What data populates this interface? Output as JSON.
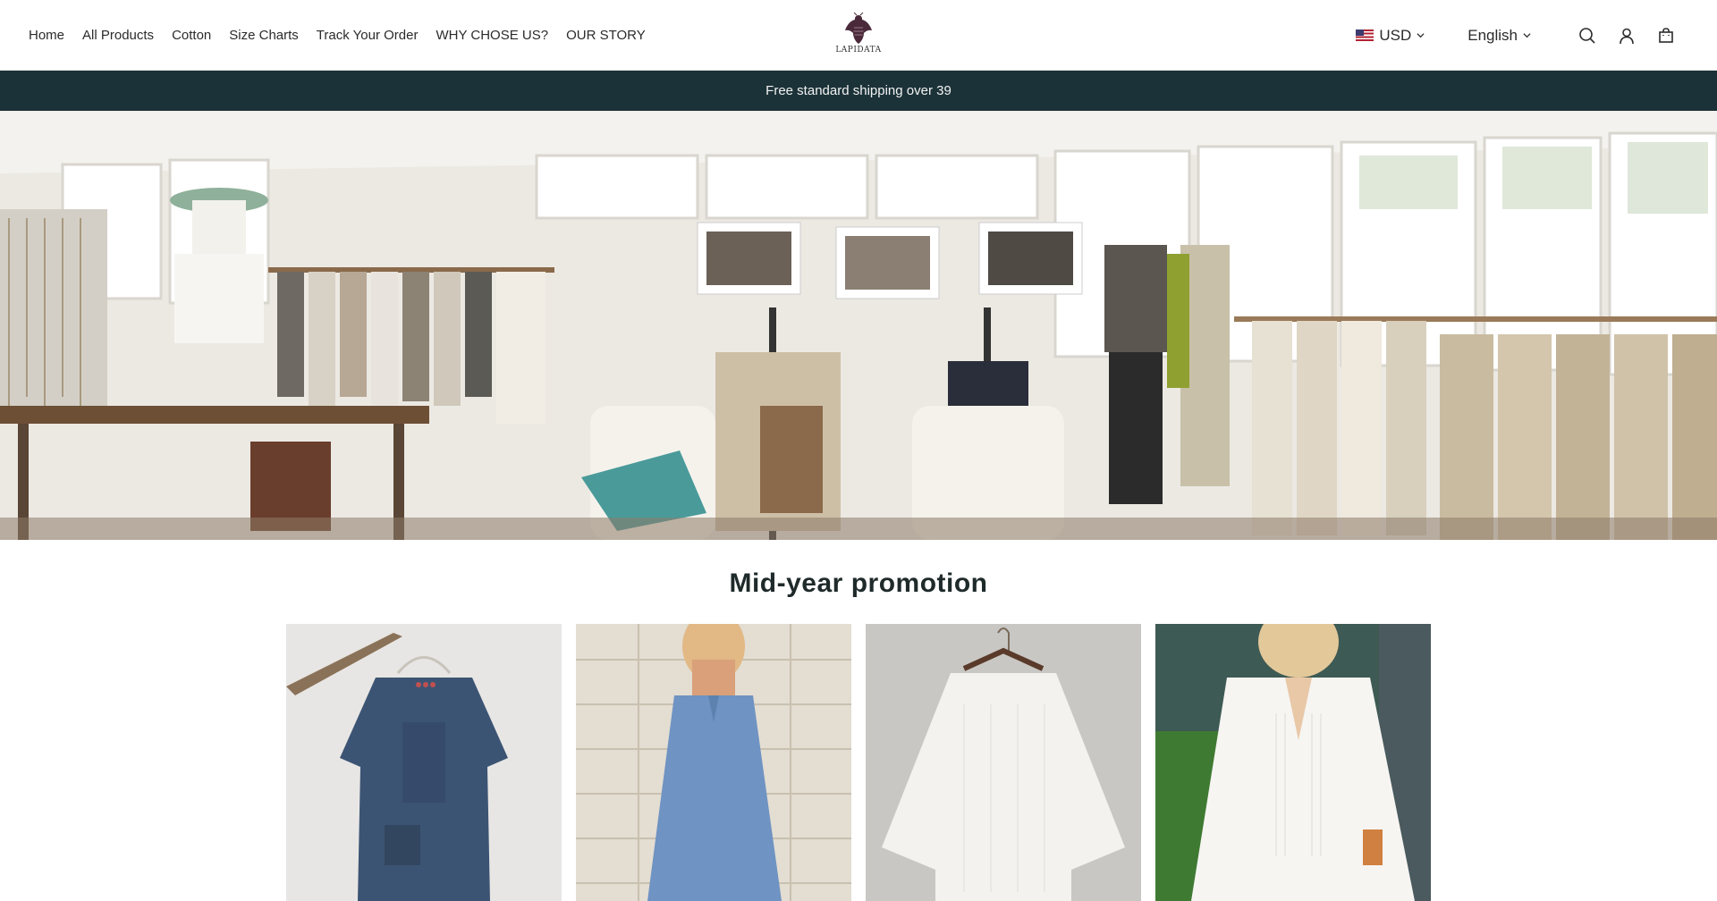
{
  "nav": {
    "items": [
      {
        "label": "Home"
      },
      {
        "label": "All Products"
      },
      {
        "label": "Cotton"
      },
      {
        "label": "Size Charts"
      },
      {
        "label": "Track Your Order"
      },
      {
        "label": "WHY CHOSE US?"
      },
      {
        "label": "OUR STORY"
      }
    ]
  },
  "brand": {
    "name": "LAPIDATA",
    "color": "#4a2a3a"
  },
  "tools": {
    "currency": "USD",
    "currency_icon": "us-flag-icon",
    "language": "English",
    "icons": [
      "search-icon",
      "account-icon",
      "cart-icon"
    ]
  },
  "announcement": {
    "text": "Free standard shipping over 39",
    "background": "#1b3238"
  },
  "hero": {
    "image": "boutique-interior-photo"
  },
  "promotion": {
    "title": "Mid-year promotion",
    "products": [
      {
        "image": "denim-tunic-dress-photo"
      },
      {
        "image": "chambray-sleeveless-dress-photo"
      },
      {
        "image": "white-gauze-top-photo"
      },
      {
        "image": "white-linen-tunic-photo"
      }
    ]
  }
}
